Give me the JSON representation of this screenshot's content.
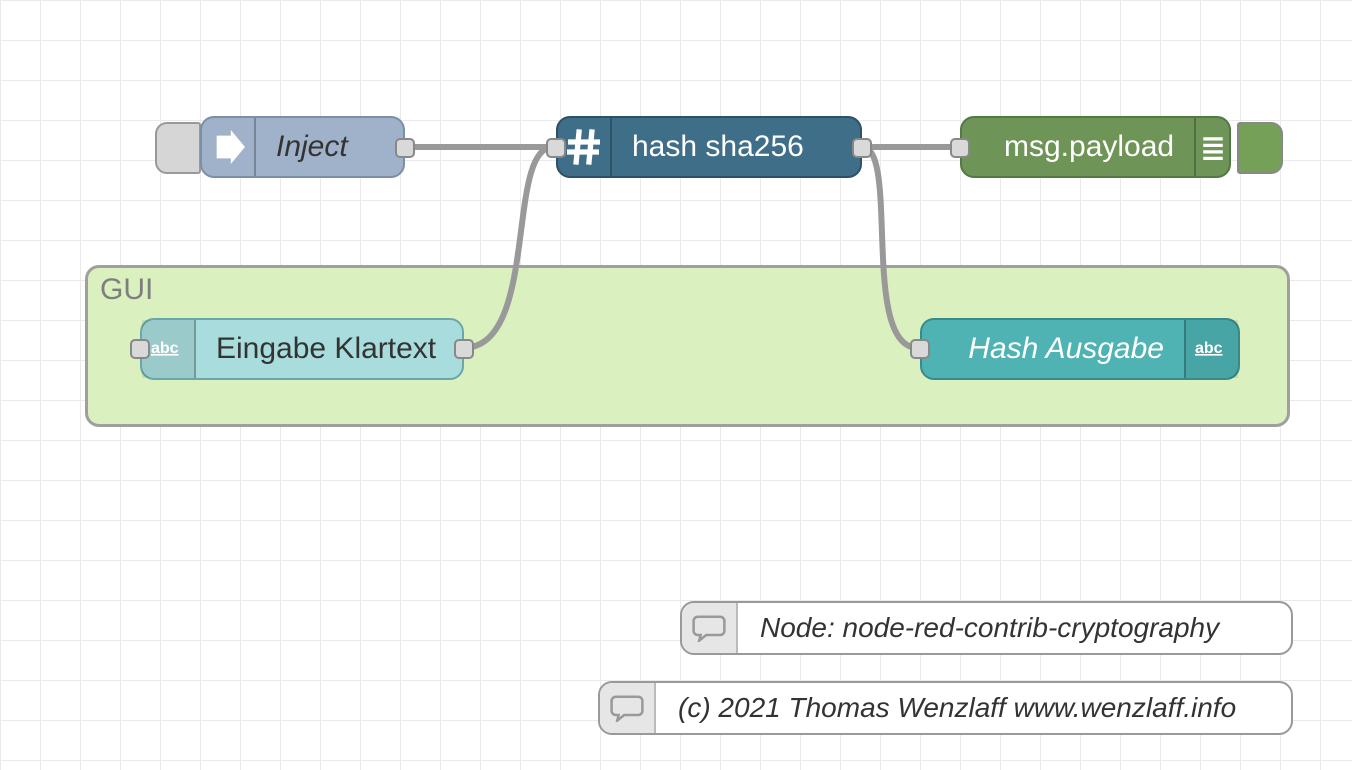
{
  "nodes": {
    "inject": {
      "label": "Inject",
      "icon": "arrow-right-icon"
    },
    "hash": {
      "label": "hash sha256",
      "icon": "hash-icon"
    },
    "debug": {
      "label": "msg.payload",
      "icon": "list-icon"
    },
    "text_input": {
      "label": "Eingabe Klartext",
      "icon": "abc-icon"
    },
    "text_output": {
      "label": "Hash Ausgabe",
      "icon": "abc-icon"
    }
  },
  "group": {
    "label": "GUI"
  },
  "comments": {
    "c1": "Node: node-red-contrib-cryptography",
    "c2": "(c) 2021 Thomas Wenzlaff www.wenzlaff.info"
  },
  "colors": {
    "inject": "#a0b2c9",
    "hash": "#3f6f88",
    "debug": "#6f9457",
    "ui_text_light": "#a9dcdc",
    "ui_text_dark": "#4fb3b3",
    "group_fill": "#daf0bf"
  }
}
